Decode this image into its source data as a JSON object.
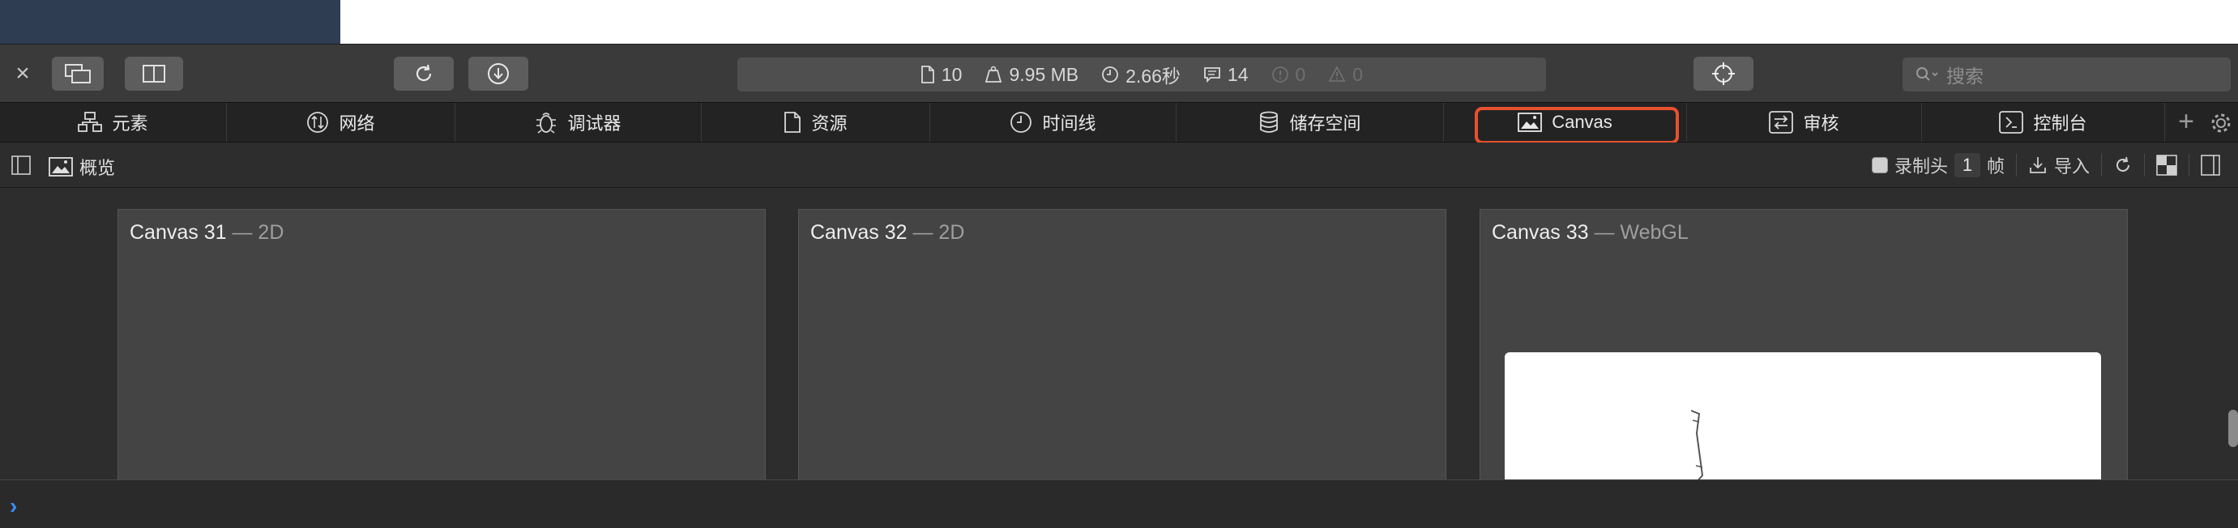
{
  "toolbar": {
    "close": "×",
    "activity": {
      "resources_count": "10",
      "size": "9.95 MB",
      "load_time": "2.66秒",
      "logs": "14",
      "errors": "0",
      "warnings": "0"
    },
    "search_placeholder": "搜索"
  },
  "tabs": [
    {
      "label": "元素",
      "icon": "elements-icon"
    },
    {
      "label": "网络",
      "icon": "network-icon"
    },
    {
      "label": "调试器",
      "icon": "debugger-icon"
    },
    {
      "label": "资源",
      "icon": "resources-icon"
    },
    {
      "label": "时间线",
      "icon": "timeline-icon"
    },
    {
      "label": "储存空间",
      "icon": "storage-icon"
    },
    {
      "label": "Canvas",
      "icon": "canvas-icon",
      "selected": true
    },
    {
      "label": "审核",
      "icon": "audit-icon"
    },
    {
      "label": "控制台",
      "icon": "console-icon"
    }
  ],
  "subbar": {
    "overview": "概览",
    "record_label": "录制头",
    "frames_value": "1",
    "frames_unit": "帧",
    "import_label": "导入"
  },
  "canvases": [
    {
      "name": "Canvas 31",
      "type": "— 2D"
    },
    {
      "name": "Canvas 32",
      "type": "— 2D"
    },
    {
      "name": "Canvas 33",
      "type": "— WebGL"
    }
  ],
  "colors": {
    "highlight": "#e8502f",
    "prompt": "#3a8ff0"
  }
}
